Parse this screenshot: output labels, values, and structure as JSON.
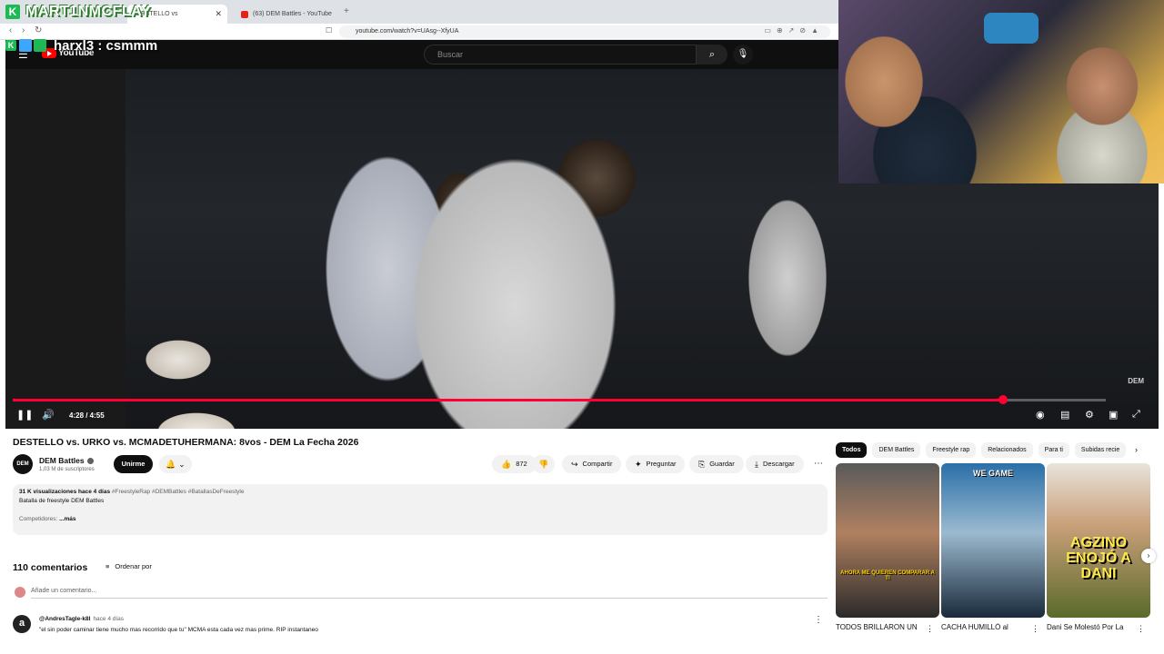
{
  "browser": {
    "tab_active_title": "DESTELLO vs",
    "tab2_title": "(63) DEM Battles - YouTube",
    "new_tab_icon": "plus-icon",
    "url": "youtube.com/watch?v=UAsg--XfyUA"
  },
  "overlay": {
    "streamer_name": "MART1NMCFLAY",
    "chat_user": "harxl3",
    "chat_message": "harxl3 : csmmm"
  },
  "youtube": {
    "logo_text": "YouTube",
    "search_placeholder": "Buscar"
  },
  "video": {
    "watermark": "DEM",
    "time_display": "4:28 / 4:55",
    "progress": 0.9058,
    "state": "playing"
  },
  "info": {
    "title": "DESTELLO vs. URKO vs. MCMADETUHERMANA: 8vos - DEM La Fecha 2026",
    "channel_avatar_text": "DEM",
    "channel_name": "DEM Battles",
    "subscribers": "1,03 M de suscriptores",
    "join_label": "Unirme",
    "likes": "872",
    "share_label": "Compartir",
    "ask_label": "Preguntar",
    "save_label": "Guardar",
    "download_label": "Descargar"
  },
  "description": {
    "meta": "31 K visualizaciones  hace 4 días",
    "tags": "#FreestyleRap #DEMBattles #BatallasDeFreestyle",
    "line1": "Batalla de freestyle DEM Battles",
    "line2": "Competidores:",
    "more": "...más"
  },
  "comments": {
    "count": "110 comentarios",
    "sort_label": "Ordenar por",
    "add_placeholder": "Añade un comentario...",
    "first": {
      "avatar_letter": "a",
      "author": "@AndresTagle-k8l",
      "time": "hace 4 días",
      "text": "\"el sin poder caminar tiene mucho mas recorrido que tu\" MCMA esta cada vez mas prime. RIP instantaneo"
    }
  },
  "sidebar": {
    "chips": [
      "Todos",
      "DEM Battles",
      "Freestyle rap",
      "Relacionados",
      "Para ti",
      "Subidas recie"
    ],
    "videos": [
      {
        "title": "TODOS BRILLARON UN",
        "overlay": "AHORA ME QUIEREN COMPARAR A TI"
      },
      {
        "title": "CACHA HUMILLÓ al",
        "overlay": "WE GAME"
      },
      {
        "title": "Dani Se Molestó Por La",
        "overlay": "AGZINO ENOJÓ A DANI"
      }
    ]
  },
  "colors": {
    "accent": "#ff0033",
    "brand": "#ff0000",
    "overlay_green": "#1db954"
  }
}
